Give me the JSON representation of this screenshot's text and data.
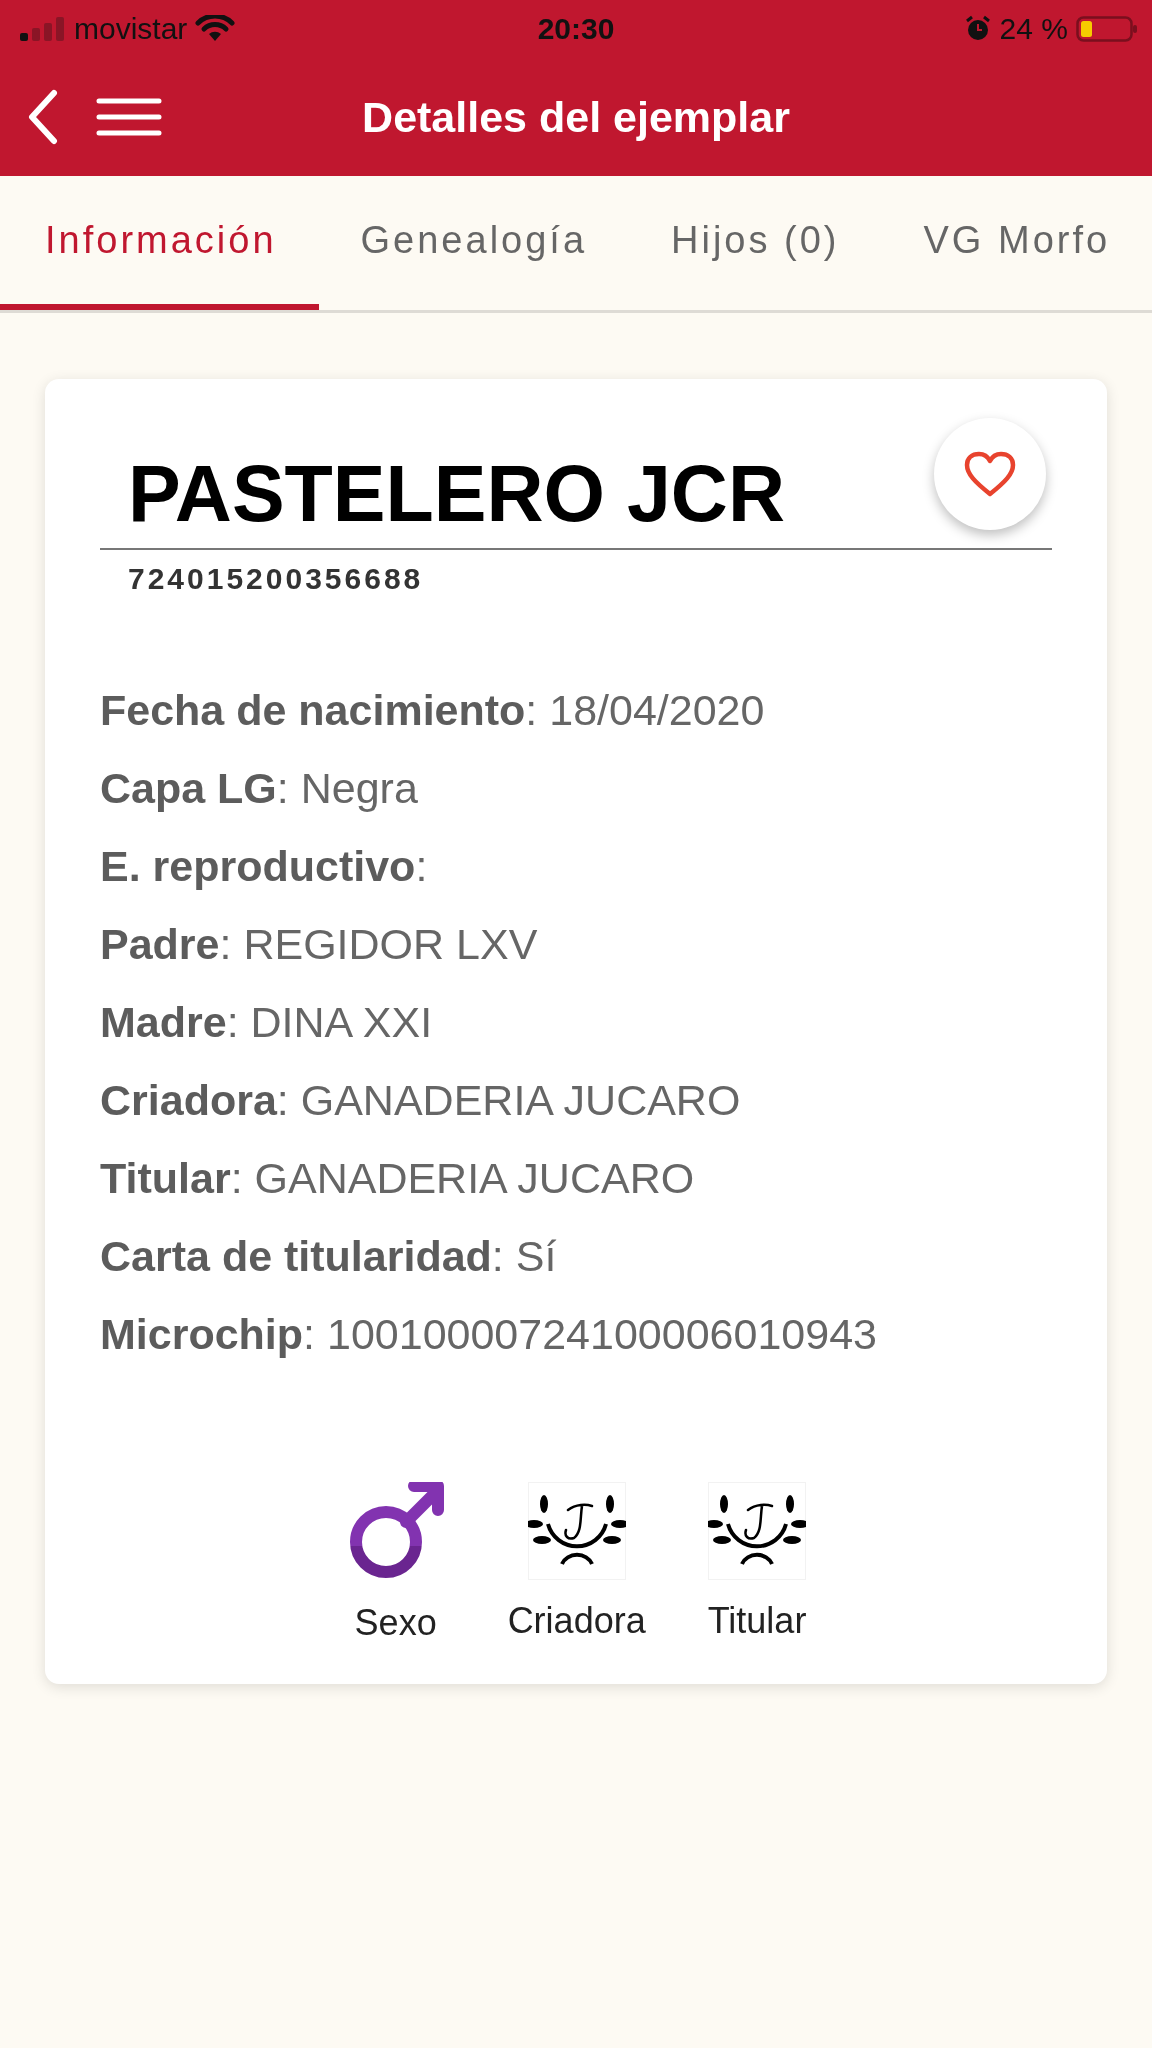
{
  "status_bar": {
    "carrier": "movistar",
    "time": "20:30",
    "battery": "24 %"
  },
  "header": {
    "title": "Detalles del ejemplar"
  },
  "tabs": [
    {
      "label": "Información",
      "selected": true
    },
    {
      "label": "Genealogía",
      "selected": false
    },
    {
      "label": "Hijos (0)",
      "selected": false
    },
    {
      "label": "VG Morfo",
      "selected": false
    }
  ],
  "animal": {
    "name": "PASTELERO JCR",
    "code": "724015200356688",
    "favorite": false,
    "fields": [
      "**Fecha de nacimiento**: 18/04/2020",
      "**Capa LG**: Negra",
      "**E. reproductivo**:",
      "**Padre**: REGIDOR LXV",
      "**Madre**: DINA XXI",
      "**Criadora**: GANADERIA JUCARO",
      "**Titular**: GANADERIA JUCARO",
      "**Carta de titularidad**: Sí",
      "**Microchip**: 10010000724100006010943"
    ],
    "badges": [
      {
        "kind": "male",
        "label": "Sexo"
      },
      {
        "kind": "laurel",
        "label": "Criadora"
      },
      {
        "kind": "laurel",
        "label": "Titular"
      }
    ]
  }
}
